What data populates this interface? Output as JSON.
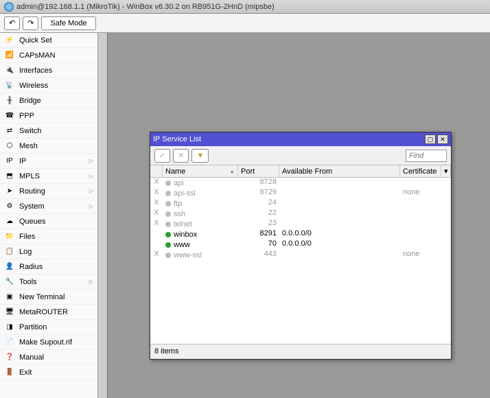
{
  "window": {
    "title": "admin@192.168.1.1 (MikroTik) - WinBox v6.30.2 on RB951G-2HnD (mipsbe)"
  },
  "toolbar": {
    "undo": "↶",
    "redo": "↷",
    "safemode": "Safe Mode"
  },
  "sidebar": {
    "items": [
      {
        "icon": "⚡",
        "label": "Quick Set",
        "sub": false
      },
      {
        "icon": "📶",
        "label": "CAPsMAN",
        "sub": false
      },
      {
        "icon": "🔌",
        "label": "Interfaces",
        "sub": false
      },
      {
        "icon": "📡",
        "label": "Wireless",
        "sub": false
      },
      {
        "icon": "╫",
        "label": "Bridge",
        "sub": false
      },
      {
        "icon": "☎",
        "label": "PPP",
        "sub": false
      },
      {
        "icon": "⇄",
        "label": "Switch",
        "sub": false
      },
      {
        "icon": "⬡",
        "label": "Mesh",
        "sub": false
      },
      {
        "icon": "IP",
        "label": "IP",
        "sub": true
      },
      {
        "icon": "⬒",
        "label": "MPLS",
        "sub": true
      },
      {
        "icon": "➤",
        "label": "Routing",
        "sub": true
      },
      {
        "icon": "⚙",
        "label": "System",
        "sub": true
      },
      {
        "icon": "☁",
        "label": "Queues",
        "sub": false
      },
      {
        "icon": "📁",
        "label": "Files",
        "sub": false
      },
      {
        "icon": "📋",
        "label": "Log",
        "sub": false
      },
      {
        "icon": "👤",
        "label": "Radius",
        "sub": false
      },
      {
        "icon": "🔧",
        "label": "Tools",
        "sub": true
      },
      {
        "icon": "▣",
        "label": "New Terminal",
        "sub": false
      },
      {
        "icon": "🖥",
        "label": "MetaROUTER",
        "sub": false
      },
      {
        "icon": "◨",
        "label": "Partition",
        "sub": false
      },
      {
        "icon": "📄",
        "label": "Make Supout.rif",
        "sub": false
      },
      {
        "icon": "❓",
        "label": "Manual",
        "sub": false
      },
      {
        "icon": "🚪",
        "label": "Exit",
        "sub": false
      }
    ]
  },
  "ipwin": {
    "title": "IP Service List",
    "find_placeholder": "Find",
    "status": "8 items",
    "columns": {
      "name": "Name",
      "port": "Port",
      "avail": "Available From",
      "cert": "Certificate"
    },
    "rows": [
      {
        "x": "X",
        "on": false,
        "name": "api",
        "port": "8728",
        "avail": "",
        "cert": ""
      },
      {
        "x": "X",
        "on": false,
        "name": "api-ssl",
        "port": "8729",
        "avail": "",
        "cert": "none"
      },
      {
        "x": "X",
        "on": false,
        "name": "ftp",
        "port": "24",
        "avail": "",
        "cert": ""
      },
      {
        "x": "X",
        "on": false,
        "name": "ssh",
        "port": "22",
        "avail": "",
        "cert": ""
      },
      {
        "x": "X",
        "on": false,
        "name": "telnet",
        "port": "23",
        "avail": "",
        "cert": ""
      },
      {
        "x": "",
        "on": true,
        "name": "winbox",
        "port": "8291",
        "avail": "0.0.0.0/0",
        "cert": ""
      },
      {
        "x": "",
        "on": true,
        "name": "www",
        "port": "70",
        "avail": "0.0.0.0/0",
        "cert": ""
      },
      {
        "x": "X",
        "on": false,
        "name": "www-ssl",
        "port": "443",
        "avail": "",
        "cert": "none"
      }
    ]
  }
}
